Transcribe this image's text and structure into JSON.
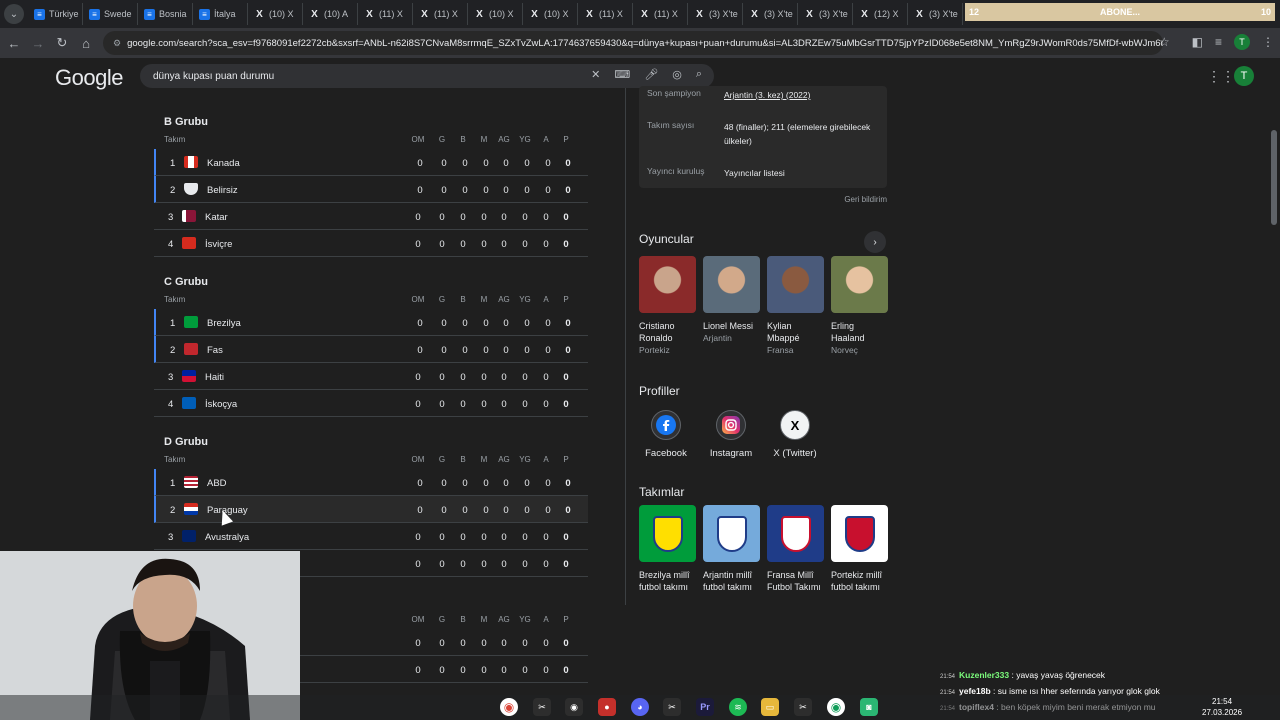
{
  "browser": {
    "tabs": [
      {
        "label": "Türkiye",
        "icon": "google-docs-icon"
      },
      {
        "label": "Swede",
        "icon": "google-docs-icon"
      },
      {
        "label": "Bosnia",
        "icon": "google-docs-icon"
      },
      {
        "label": "İtalya",
        "icon": "google-docs-icon"
      },
      {
        "label": "(10) X",
        "icon": "x-icon"
      },
      {
        "label": "(10) A",
        "icon": "x-icon"
      },
      {
        "label": "(11) X",
        "icon": "x-icon"
      },
      {
        "label": "(11) X",
        "icon": "x-icon"
      },
      {
        "label": "(10) X",
        "icon": "x-icon"
      },
      {
        "label": "(10) X",
        "icon": "x-icon"
      },
      {
        "label": "(11) X",
        "icon": "x-icon"
      },
      {
        "label": "(11) X",
        "icon": "x-icon"
      },
      {
        "label": "(3) X'te",
        "icon": "x-icon"
      },
      {
        "label": "(3) X'te",
        "icon": "x-icon"
      },
      {
        "label": "(3) X'te",
        "icon": "x-icon"
      },
      {
        "label": "(12) X",
        "icon": "x-icon"
      },
      {
        "label": "(3) X'te",
        "icon": "x-icon"
      }
    ],
    "overlay": {
      "left": "12",
      "center": "ABONE...",
      "right": "10"
    },
    "url": "google.com/search?sca_esv=f9768091ef2272cb&sxsrf=ANbL-n62i8S7CNvaM8srrmqE_SZxTvZwLA:1774637659430&q=dünya+kupası+puan+durumu&si=AL3DRZEw75uMbGsrTTD75jpYPzID068e5et8NM_YmRgZ9rJWomR0ds75MfDf-wbWJm6d..."
  },
  "google": {
    "logo": "Google",
    "query": "dünya kupası puan durumu",
    "avatar": "T"
  },
  "standings": {
    "columns": [
      "OM",
      "G",
      "B",
      "M",
      "AG",
      "YG",
      "A",
      "P"
    ],
    "team_header": "Takım",
    "groups": [
      {
        "title": "B Grubu",
        "rows": [
          {
            "pos": "1",
            "team": "Kanada",
            "stats": [
              "0",
              "0",
              "0",
              "0",
              "0",
              "0",
              "0",
              "0"
            ]
          },
          {
            "pos": "2",
            "team": "Belirsiz",
            "stats": [
              "0",
              "0",
              "0",
              "0",
              "0",
              "0",
              "0",
              "0"
            ]
          },
          {
            "pos": "3",
            "team": "Katar",
            "stats": [
              "0",
              "0",
              "0",
              "0",
              "0",
              "0",
              "0",
              "0"
            ]
          },
          {
            "pos": "4",
            "team": "İsviçre",
            "stats": [
              "0",
              "0",
              "0",
              "0",
              "0",
              "0",
              "0",
              "0"
            ]
          }
        ]
      },
      {
        "title": "C Grubu",
        "rows": [
          {
            "pos": "1",
            "team": "Brezilya",
            "stats": [
              "0",
              "0",
              "0",
              "0",
              "0",
              "0",
              "0",
              "0"
            ]
          },
          {
            "pos": "2",
            "team": "Fas",
            "stats": [
              "0",
              "0",
              "0",
              "0",
              "0",
              "0",
              "0",
              "0"
            ]
          },
          {
            "pos": "3",
            "team": "Haiti",
            "stats": [
              "0",
              "0",
              "0",
              "0",
              "0",
              "0",
              "0",
              "0"
            ]
          },
          {
            "pos": "4",
            "team": "İskoçya",
            "stats": [
              "0",
              "0",
              "0",
              "0",
              "0",
              "0",
              "0",
              "0"
            ]
          }
        ]
      },
      {
        "title": "D Grubu",
        "rows": [
          {
            "pos": "1",
            "team": "ABD",
            "stats": [
              "0",
              "0",
              "0",
              "0",
              "0",
              "0",
              "0",
              "0"
            ]
          },
          {
            "pos": "2",
            "team": "Paraguay",
            "stats": [
              "0",
              "0",
              "0",
              "0",
              "0",
              "0",
              "0",
              "0"
            ]
          },
          {
            "pos": "3",
            "team": "Avustralya",
            "stats": [
              "0",
              "0",
              "0",
              "0",
              "0",
              "0",
              "0",
              "0"
            ]
          },
          {
            "pos": "",
            "team": "",
            "stats": [
              "0",
              "0",
              "0",
              "0",
              "0",
              "0",
              "0",
              "0"
            ]
          }
        ]
      },
      {
        "title": "",
        "rows": [
          {
            "pos": "",
            "team": "",
            "stats": [
              "0",
              "0",
              "0",
              "0",
              "0",
              "0",
              "0",
              "0"
            ]
          },
          {
            "pos": "",
            "team": "",
            "stats": [
              "0",
              "0",
              "0",
              "0",
              "0",
              "0",
              "0",
              "0"
            ]
          }
        ]
      }
    ]
  },
  "knowledge_panel": {
    "info": [
      {
        "key": "Son şampiyon",
        "value": "Arjantin (3. kez) (2022)"
      },
      {
        "key": "Takım sayısı",
        "value": "48 (finaller); 211 (elemelere girebilecek ülkeler)"
      },
      {
        "key": "Yayıncı kuruluş",
        "value": "Yayıncılar listesi"
      }
    ],
    "feedback": "Geri bildirim",
    "players_title": "Oyuncular",
    "players": [
      {
        "name": "Cristiano Ronaldo",
        "country": "Portekiz"
      },
      {
        "name": "Lionel Messi",
        "country": "Arjantin"
      },
      {
        "name": "Kylian Mbappé",
        "country": "Fransa"
      },
      {
        "name": "Erling Haaland",
        "country": "Norveç"
      }
    ],
    "profiles_title": "Profiller",
    "profiles": [
      {
        "label": "Facebook",
        "icon": "facebook-icon"
      },
      {
        "label": "Instagram",
        "icon": "instagram-icon"
      },
      {
        "label": "X (Twitter)",
        "icon": "x-twitter-icon"
      }
    ],
    "teams_title": "Takımlar",
    "teams": [
      {
        "name": "Brezilya millî futbol takımı"
      },
      {
        "name": "Arjantin millî futbol takımı"
      },
      {
        "name": "Fransa Millî Futbol Takımı"
      },
      {
        "name": "Portekiz millî futbol takımı"
      }
    ]
  },
  "chat": [
    {
      "time": "21:54",
      "user": "Kuzenler333",
      "text": " : yavaş yavaş öğrenecek"
    },
    {
      "time": "21:54",
      "user": "yefe18b",
      "text": " : su isme ısı hher seferında yarıyor glok glok"
    },
    {
      "time": "21:54",
      "user": "topiflex4",
      "text": " : ben köpek miyim beni merak etmiyon mu"
    }
  ],
  "clock": {
    "time": "21:54",
    "date": "27.03.2026"
  }
}
